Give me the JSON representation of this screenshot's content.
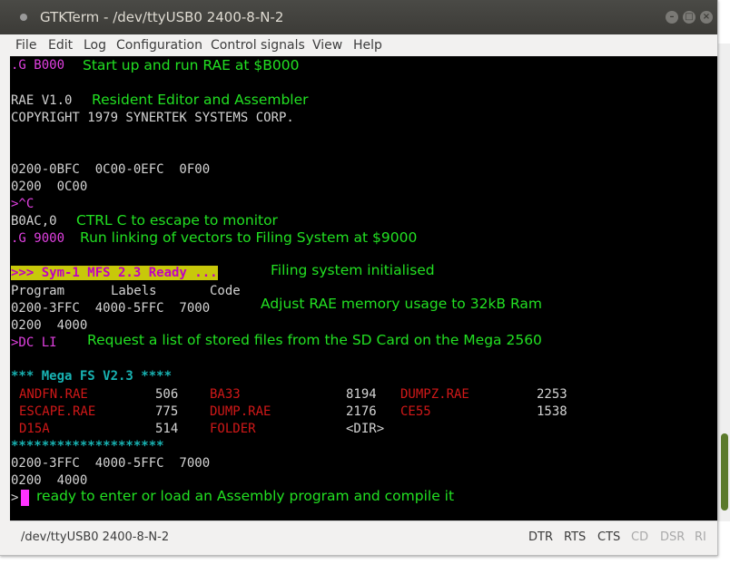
{
  "window": {
    "title": "GTKTerm - /dev/ttyUSB0  2400-8-N-2",
    "minimize": "–",
    "maximize": "□",
    "close": "×"
  },
  "menu": {
    "file": "File",
    "edit": "Edit",
    "log": "Log",
    "configuration": "Configuration",
    "control_signals": "Control signals",
    "view": "View",
    "help": "Help"
  },
  "terminal": {
    "l_g_b000": ".G B000",
    "l_rae_v": "RAE V1.0",
    "l_copyright": "COPYRIGHT 1979 SYNERTEK SYSTEMS CORP.",
    "l_mem1": "0200-0BFC  0C00-0EFC  0F00",
    "l_mem2": "0200  0C00",
    "l_ctrlc": ">^C",
    "l_b0ac": "B0AC,0",
    "l_g_9000": ".G 9000",
    "l_mfs": ">>> Sym-1 MFS 2.3 Ready ...",
    "l_hdr_program": "Program",
    "l_hdr_labels": "Labels",
    "l_hdr_code": "Code",
    "l_mem3": "0200-3FFC  4000-5FFC  7000",
    "l_mem4": "0200  4000",
    "l_dcli": ">DC LI",
    "l_megafs": "*** Mega FS V2.3 ****",
    "files": {
      "f1": "ANDFN.RAE",
      "s1": "506",
      "f2": "BA33",
      "s2": "8194",
      "f3": "DUMPZ.RAE",
      "s3": "2253",
      "f4": "ESCAPE.RAE",
      "s4": "775",
      "f5": "DUMP.RAE",
      "s5": "2176",
      "f6": "CE55",
      "s6": "1538",
      "f7": "D15A",
      "s7": "514",
      "f8": "FOLDER",
      "s8": "<DIR>"
    },
    "l_stars": "********************",
    "l_mem5": "0200-3FFC  4000-5FFC  7000",
    "l_mem6": "0200  4000",
    "l_prompt": ">"
  },
  "annotations": {
    "a1": "Start up and run RAE at $B000",
    "a2": "Resident Editor and Assembler",
    "a3": "CTRL C to escape to monitor",
    "a4": "Run linking of vectors to Filing System at $9000",
    "a5": "Filing system initialised",
    "a6": "Adjust RAE memory usage to 32kB Ram",
    "a7": "Request a list of stored files from the SD Card on the Mega 2560",
    "a8": "ready to enter or load an Assembly program and compile it"
  },
  "status": {
    "port": "/dev/ttyUSB0  2400-8-N-2",
    "dtr": "DTR",
    "rts": "RTS",
    "cts": "CTS",
    "cd": "CD",
    "dsr": "DSR",
    "ri": "RI"
  },
  "colors": {
    "terminal_bg": "#000000",
    "terminal_text": "#d3d3d3",
    "annotation": "#22e022",
    "prompt_magenta": "#e040e0",
    "highlight_bg": "#c8c80a",
    "filename_red": "#d01818",
    "header_cyan": "#18b2b2",
    "cursor": "#ff33ff"
  }
}
